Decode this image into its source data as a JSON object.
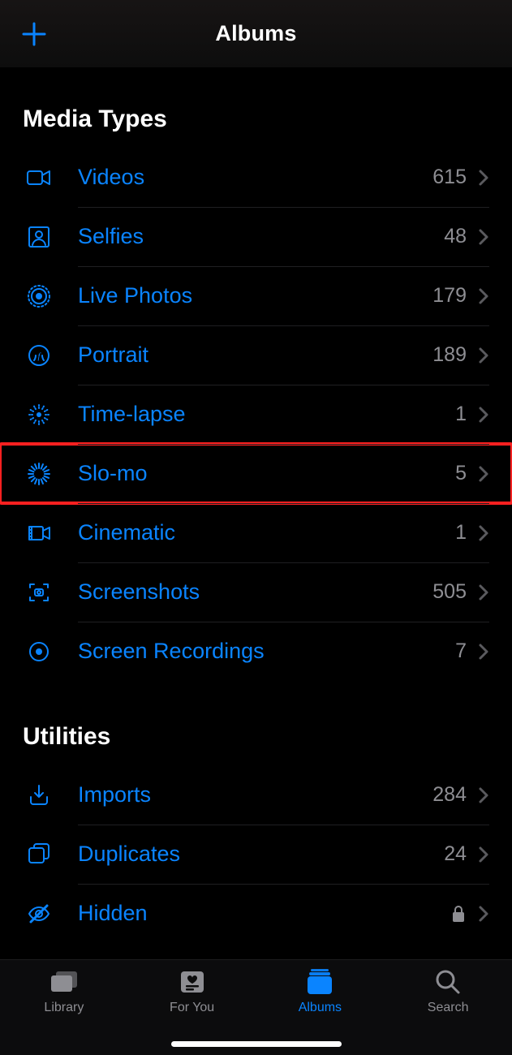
{
  "header": {
    "title": "Albums"
  },
  "sections": [
    {
      "title": "Media Types",
      "items": [
        {
          "icon": "video",
          "label": "Videos",
          "count": "615",
          "highlight": false
        },
        {
          "icon": "selfie",
          "label": "Selfies",
          "count": "48",
          "highlight": false
        },
        {
          "icon": "livephoto",
          "label": "Live Photos",
          "count": "179",
          "highlight": false
        },
        {
          "icon": "portrait",
          "label": "Portrait",
          "count": "189",
          "highlight": false
        },
        {
          "icon": "timelapse",
          "label": "Time-lapse",
          "count": "1",
          "highlight": false
        },
        {
          "icon": "slomo",
          "label": "Slo-mo",
          "count": "5",
          "highlight": true
        },
        {
          "icon": "cinematic",
          "label": "Cinematic",
          "count": "1",
          "highlight": false
        },
        {
          "icon": "screenshot",
          "label": "Screenshots",
          "count": "505",
          "highlight": false
        },
        {
          "icon": "screenrec",
          "label": "Screen Recordings",
          "count": "7",
          "highlight": false
        }
      ]
    },
    {
      "title": "Utilities",
      "items": [
        {
          "icon": "imports",
          "label": "Imports",
          "count": "284",
          "highlight": false
        },
        {
          "icon": "duplicates",
          "label": "Duplicates",
          "count": "24",
          "highlight": false
        },
        {
          "icon": "hidden",
          "label": "Hidden",
          "locked": true,
          "highlight": false
        }
      ]
    }
  ],
  "tabs": [
    {
      "key": "library",
      "label": "Library",
      "active": false
    },
    {
      "key": "foryou",
      "label": "For You",
      "active": false
    },
    {
      "key": "albums",
      "label": "Albums",
      "active": true
    },
    {
      "key": "search",
      "label": "Search",
      "active": false
    }
  ]
}
